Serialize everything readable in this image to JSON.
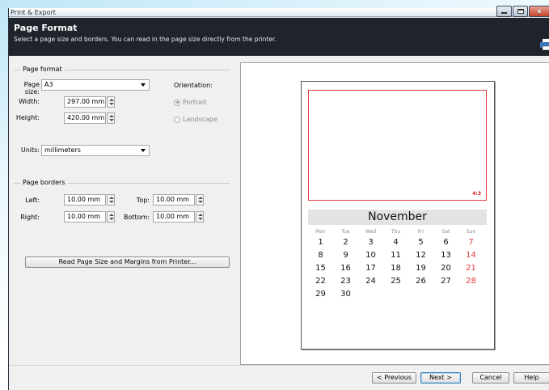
{
  "window": {
    "title": "Print & Export",
    "close_label": "x"
  },
  "header": {
    "title": "Page Format",
    "subtitle": "Select a page size and borders. You can read in the page size directly from the printer."
  },
  "page_format": {
    "group_label": "Page format",
    "page_size_label": "Page size:",
    "page_size_value": "A3",
    "width_label": "Width:",
    "width_value": "297.00 mm",
    "height_label": "Height:",
    "height_value": "420.00 mm",
    "orientation_label": "Orientation:",
    "portrait_label": "Portrait",
    "landscape_label": "Landscape",
    "units_label": "Units:",
    "units_value": "millimeters"
  },
  "page_borders": {
    "group_label": "Page borders",
    "left_label": "Left:",
    "left_value": "10.00 mm",
    "top_label": "Top:",
    "top_value": "10.00 mm",
    "right_label": "Right:",
    "right_value": "10.00 mm",
    "bottom_label": "Bottom:",
    "bottom_value": "10.00 mm"
  },
  "read_printer_button": "Read Page Size and Margins from Printer...",
  "preview": {
    "ratio_label": "4:3",
    "month": "November",
    "days_of_week": [
      "Mon",
      "Tue",
      "Wed",
      "Thu",
      "Fri",
      "Sat",
      "Sun"
    ],
    "weeks": [
      [
        "1",
        "2",
        "3",
        "4",
        "5",
        "6",
        "7"
      ],
      [
        "8",
        "9",
        "10",
        "11",
        "12",
        "13",
        "14"
      ],
      [
        "15",
        "16",
        "17",
        "18",
        "19",
        "20",
        "21"
      ],
      [
        "22",
        "23",
        "24",
        "25",
        "26",
        "27",
        "28"
      ],
      [
        "29",
        "30",
        "",
        "",
        "",
        "",
        ""
      ]
    ]
  },
  "footer": {
    "previous_label": "< Previous",
    "next_label": "Next >",
    "cancel_label": "Cancel",
    "help_label": "Help"
  },
  "colors": {
    "header_bg": "#1e232c",
    "accent_red": "#e53a3a",
    "window_bg": "#f0f0f0"
  }
}
